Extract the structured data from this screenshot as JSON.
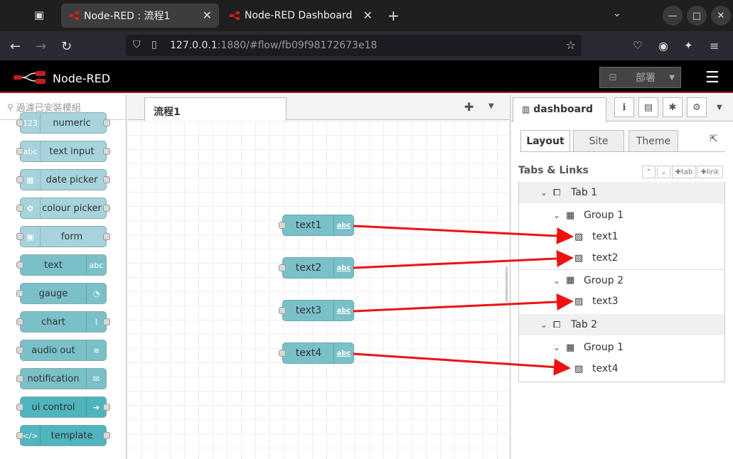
{
  "browser": {
    "tabs": [
      {
        "title": "Node-RED : 流程1"
      },
      {
        "title": "Node-RED Dashboard"
      }
    ],
    "url_host": "127.0.0.1",
    "url_rest": ":1880/#flow/fb09f98172673e18"
  },
  "header": {
    "app_title": "Node-RED",
    "deploy_label": "部署"
  },
  "palette": {
    "filter_placeholder": "過濾已安裝模組",
    "nodes": [
      {
        "label": "numeric",
        "icon": "123",
        "icon_side": "left",
        "color": "#a6d3dc"
      },
      {
        "label": "text input",
        "icon": "abc",
        "icon_side": "left",
        "color": "#a6d3dc"
      },
      {
        "label": "date picker",
        "icon": "calendar-icon",
        "icon_side": "left",
        "color": "#a6d3dc"
      },
      {
        "label": "colour picker",
        "icon": "palette-icon",
        "icon_side": "left",
        "color": "#a6d3dc"
      },
      {
        "label": "form",
        "icon": "form-icon",
        "icon_side": "left",
        "color": "#a6d3dc"
      },
      {
        "label": "text",
        "icon": "abc",
        "icon_side": "right",
        "color": "#7ac0c9"
      },
      {
        "label": "gauge",
        "icon": "gauge-icon",
        "icon_side": "right",
        "color": "#7ac0c9"
      },
      {
        "label": "chart",
        "icon": "chart-icon",
        "icon_side": "right",
        "color": "#7ac0c9"
      },
      {
        "label": "audio out",
        "icon": "wifi-icon",
        "icon_side": "right",
        "color": "#7ac0c9"
      },
      {
        "label": "notification",
        "icon": "envelope-icon",
        "icon_side": "right",
        "color": "#7ac0c9"
      },
      {
        "label": "ui control",
        "icon": "arrow-icon",
        "icon_side": "right",
        "color": "#4eb4bd"
      },
      {
        "label": "template",
        "icon": "code-icon",
        "icon_side": "left",
        "color": "#4eb4bd"
      }
    ]
  },
  "workspace": {
    "tab_label": "流程1",
    "nodes": [
      {
        "label": "text1",
        "icon": "abc"
      },
      {
        "label": "text2",
        "icon": "abc"
      },
      {
        "label": "text3",
        "icon": "abc"
      },
      {
        "label": "text4",
        "icon": "abc"
      }
    ]
  },
  "sidebar": {
    "tab_label": "dashboard",
    "subtabs": [
      "Layout",
      "Site",
      "Theme"
    ],
    "section_title": "Tabs & Links",
    "small_buttons": [
      "tab",
      "link"
    ],
    "tree": [
      {
        "label": "Tab 1",
        "kind": "tab"
      },
      {
        "label": "Group 1",
        "kind": "group"
      },
      {
        "label": "text1",
        "kind": "widget"
      },
      {
        "label": "text2",
        "kind": "widget"
      },
      {
        "label": "Group 2",
        "kind": "group"
      },
      {
        "label": "text3",
        "kind": "widget"
      },
      {
        "label": "Tab 2",
        "kind": "tab"
      },
      {
        "label": "Group 1",
        "kind": "group"
      },
      {
        "label": "text4",
        "kind": "widget"
      }
    ]
  },
  "annotation_color": "#ee1111"
}
